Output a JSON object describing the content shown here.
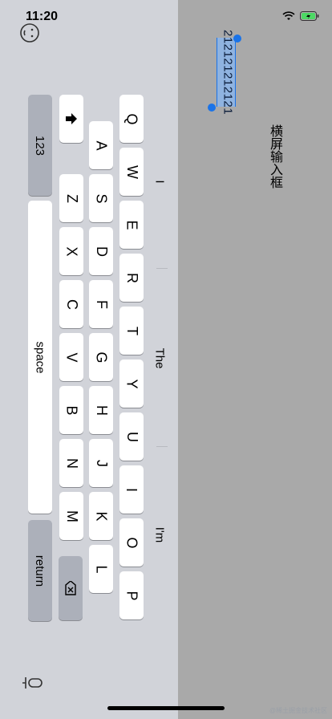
{
  "status": {
    "time": "11:20",
    "wifi_icon": "wifi-icon",
    "battery_icon": "battery-icon"
  },
  "app": {
    "field_value": "212121212121",
    "label": "横屏输入框"
  },
  "keyboard": {
    "suggestions": [
      "I",
      "The",
      "I'm"
    ],
    "row1": [
      "Q",
      "W",
      "E",
      "R",
      "T",
      "Y",
      "U",
      "I",
      "O",
      "P"
    ],
    "row2": [
      "A",
      "S",
      "D",
      "F",
      "G",
      "H",
      "J",
      "K",
      "L"
    ],
    "row3": [
      "Z",
      "X",
      "C",
      "V",
      "B",
      "N",
      "M"
    ],
    "numbers_label": "123",
    "space_label": "space",
    "return_label": "return",
    "shift_icon": "shift-icon",
    "delete_icon": "delete-icon",
    "emoji_icon": "emoji-icon",
    "dictation_icon": "dictation-icon"
  },
  "watermark": "@稀土掘金技术社区"
}
